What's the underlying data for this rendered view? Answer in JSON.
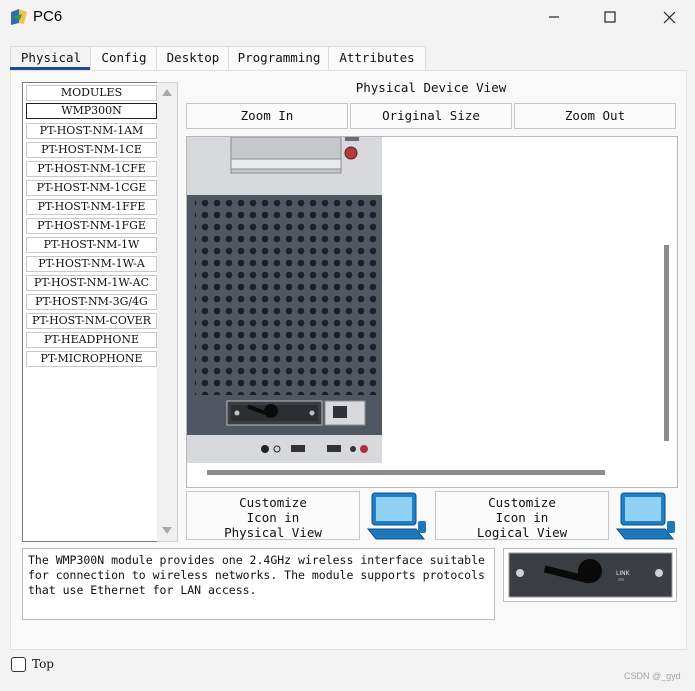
{
  "window": {
    "title": "PC6"
  },
  "tabs": [
    {
      "label": "Physical",
      "active": true
    },
    {
      "label": "Config",
      "active": false
    },
    {
      "label": "Desktop",
      "active": false
    },
    {
      "label": "Programming",
      "active": false
    },
    {
      "label": "Attributes",
      "active": false
    }
  ],
  "modules": {
    "items": [
      "MODULES",
      "WMP300N",
      "PT-HOST-NM-1AM",
      "PT-HOST-NM-1CE",
      "PT-HOST-NM-1CFE",
      "PT-HOST-NM-1CGE",
      "PT-HOST-NM-1FFE",
      "PT-HOST-NM-1FGE",
      "PT-HOST-NM-1W",
      "PT-HOST-NM-1W-A",
      "PT-HOST-NM-1W-AC",
      "PT-HOST-NM-3G/4G",
      "PT-HOST-NM-COVER",
      "PT-HEADPHONE",
      "PT-MICROPHONE"
    ],
    "selected": "WMP300N"
  },
  "physical_view": {
    "title": "Physical Device View",
    "zoom_in": "Zoom In",
    "original_size": "Original Size",
    "zoom_out": "Zoom Out"
  },
  "customize": {
    "physical": [
      "Customize",
      "Icon in",
      "Physical View"
    ],
    "logical": [
      "Customize",
      "Icon in",
      "Logical View"
    ]
  },
  "description": "The WMP300N module provides one 2.4GHz wireless interface suitable\nfor connection to wireless networks. The module supports protocols\nthat use Ethernet for LAN access.",
  "thumbnail_label": "LINK",
  "footer": {
    "top_label": "Top",
    "watermark": "CSDN @_gyd"
  },
  "colors": {
    "tab_underline": "#1b4f8a",
    "case_panel": "#4f5763",
    "case_grey": "#d7d9dc"
  }
}
